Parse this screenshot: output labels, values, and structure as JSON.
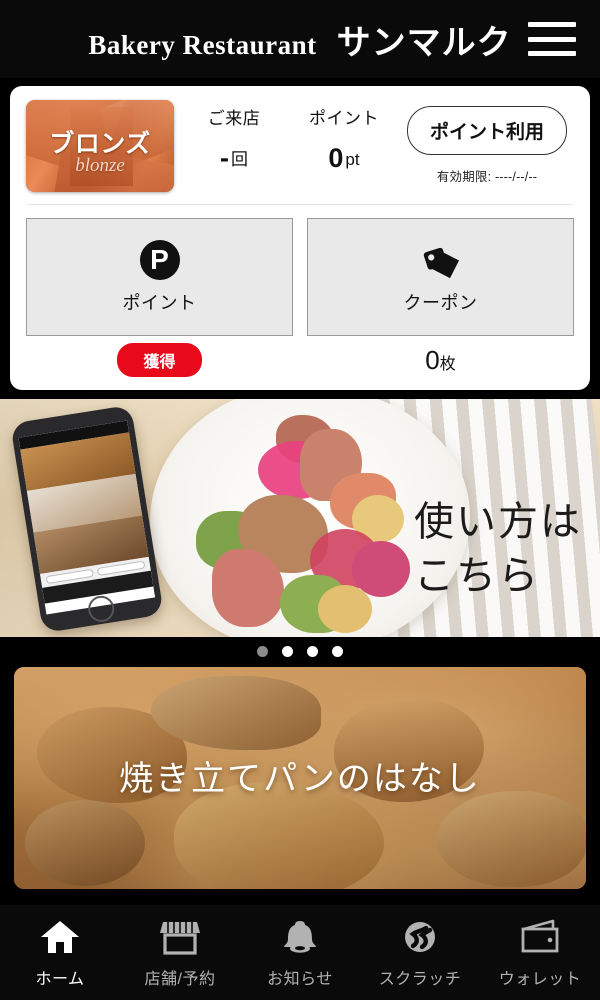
{
  "header": {
    "brand_en": "Bakery Restaurant",
    "brand_jp": "サンマルク",
    "menu_icon": "hamburger-menu-icon"
  },
  "member_card": {
    "rank_label": "ブロンズ",
    "rank_sub": "blonze",
    "visits": {
      "label": "ご来店",
      "value": "-",
      "unit": "回"
    },
    "points": {
      "label": "ポイント",
      "value": "0",
      "unit": "pt"
    },
    "use_points_button": "ポイント利用",
    "expiry": "有効期限: ----/--/--"
  },
  "tiles": {
    "points": {
      "label": "ポイント",
      "icon": "circled-p-icon",
      "badge": "獲得"
    },
    "coupon": {
      "label": "クーポン",
      "icon": "price-tag-icon",
      "count": "0",
      "count_unit": "枚"
    }
  },
  "banner_carousel": {
    "slide_text_line1": "使い方は",
    "slide_text_line2": "こちら",
    "dots_total": 4,
    "active_dot_index": 0
  },
  "banner_bread": {
    "title": "焼き立てパンのはなし"
  },
  "bottom_nav": {
    "items": [
      {
        "label": "ホーム",
        "icon": "home-icon",
        "active": true
      },
      {
        "label": "店舗/予約",
        "icon": "store-icon",
        "active": false
      },
      {
        "label": "お知らせ",
        "icon": "bell-icon",
        "active": false
      },
      {
        "label": "スクラッチ",
        "icon": "scratch-icon",
        "active": false
      },
      {
        "label": "ウォレット",
        "icon": "wallet-icon",
        "active": false
      }
    ]
  },
  "colors": {
    "background": "#000000",
    "header_bg": "#0a0a0a",
    "panel_bg": "#ffffff",
    "accent_red": "#e8091b",
    "tile_bg": "#e9e9e9",
    "nav_active": "#ffffff",
    "nav_inactive": "#b2b2b2",
    "bronze": "#c4622f"
  }
}
